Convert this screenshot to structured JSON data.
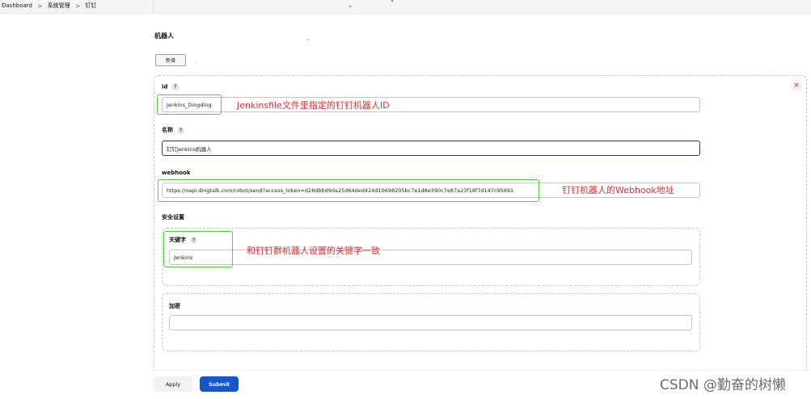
{
  "breadcrumb": [
    "Dashboard",
    "系统管理",
    "钉钉"
  ],
  "breadcrumb_separator": ">",
  "section_title": "机器人",
  "add_button": "新增",
  "close_glyph": "×",
  "help_glyph": "?",
  "fields": {
    "id": {
      "label": "id",
      "value": "Jenkins_Dingding"
    },
    "name": {
      "label": "名称",
      "value": "钉钉Jenkins机器人"
    },
    "webhook": {
      "label": "webhook",
      "value": "https://oapi.dingtalk.com/robot/send?access_token=d28dbbd9da25d64ded424d10698205bc7e1d8e390c7e87a23f18f7d147c95691"
    }
  },
  "security": {
    "label": "安全设置",
    "keyword": {
      "label": "关键字",
      "value": "Jenkins"
    },
    "secret": {
      "label": "加密",
      "value": ""
    }
  },
  "annotations": {
    "id": "Jenkinsfile文件里指定的钉钉机器人ID",
    "webhook": "钉钉机器人的Webhook地址",
    "keyword": "和钉钉群机器人设置的关键字一致"
  },
  "buttons": {
    "apply": "Apply",
    "submit": "Submit"
  },
  "watermark": "CSDN @勤奋的树懒",
  "colors": {
    "annotation_red": "#e53030",
    "highlight_green": "#4cd137",
    "submit_blue": "#1657c8"
  }
}
